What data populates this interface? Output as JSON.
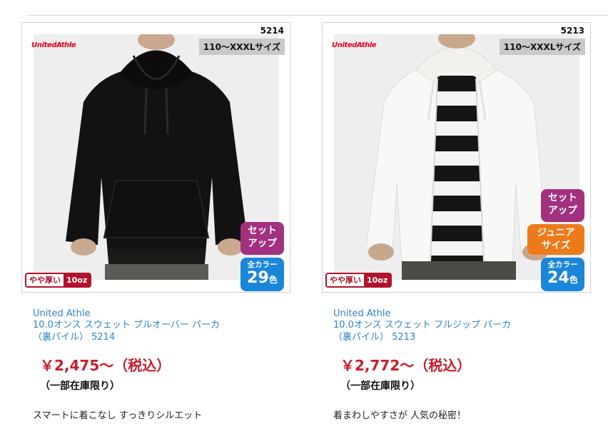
{
  "products": [
    {
      "code": "5214",
      "size_range": "110〜XXXLサイズ",
      "logo": "UnitedAthle",
      "badges": {
        "setup": [
          "セット",
          "アップ"
        ]
      },
      "color_badge": {
        "label": "全カラー",
        "count": "29",
        "unit": "色"
      },
      "thickness": {
        "label": "やや厚い",
        "weight": "10oz"
      },
      "brand": "United Athle",
      "name_line1": "10.0オンス スウェット プルオーバー パーカ",
      "name_line2": "（裏パイル） 5214",
      "price": "￥2,475〜（税込）",
      "stock_note": "（一部在庫限り）",
      "catchphrase": "スマートに着こなし すっきりシルエット",
      "garment_color": "#111111"
    },
    {
      "code": "5213",
      "size_range": "110〜XXXLサイズ",
      "logo": "UnitedAthle",
      "badges": {
        "setup": [
          "セット",
          "アップ"
        ],
        "junior": [
          "ジュニア",
          "サイズ"
        ]
      },
      "color_badge": {
        "label": "全カラー",
        "count": "24",
        "unit": "色"
      },
      "thickness": {
        "label": "やや厚い",
        "weight": "10oz"
      },
      "brand": "United Athle",
      "name_line1": "10.0オンス スウェット フルジップ パーカ",
      "name_line2": "（裏パイル） 5213",
      "price": "￥2,772〜（税込）",
      "stock_note": "（一部在庫限り）",
      "catchphrase": "着まわしやすさが 人気の秘密！",
      "garment_color": "#f7f7f5"
    }
  ],
  "colors": {
    "link": "#2e85c9",
    "price": "#c81d2e",
    "setup": "#a2317f",
    "junior": "#ed7a1a",
    "allcolor": "#1a86d9",
    "thickness": "#b3122b"
  }
}
